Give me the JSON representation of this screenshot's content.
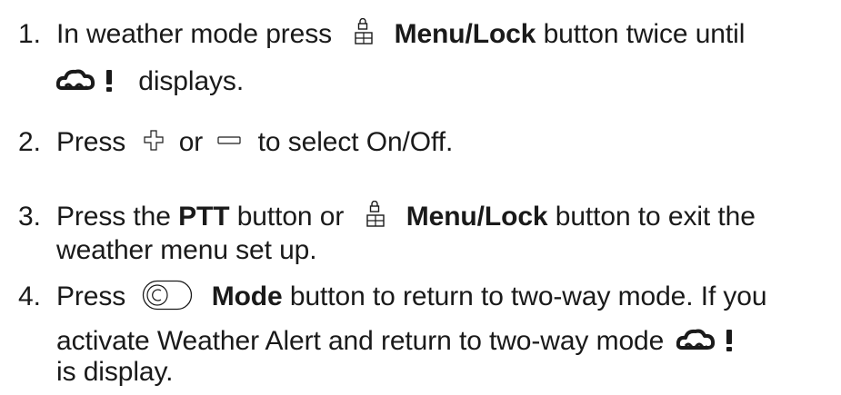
{
  "steps": [
    {
      "number": "1.",
      "line1_a": "In weather mode press",
      "line1_icon": "menu-lock-icon",
      "line1_b": "Menu/Lock",
      "line1_c": "button twice until",
      "line2_icon": "weather-alert-icon",
      "line2_text": "displays."
    },
    {
      "number": "2.",
      "a": "Press",
      "plus_icon": "plus-icon",
      "b": "or",
      "minus_icon": "minus-icon",
      "c": "to select On/Off."
    },
    {
      "number": "3.",
      "line1_a": "Press the",
      "line1_b": "PTT",
      "line1_c": "button or",
      "line1_icon": "menu-lock-icon",
      "line1_d": "Menu/Lock",
      "line1_e": "button to exit the",
      "line2": "weather menu set up."
    },
    {
      "number": "4.",
      "line1_a": "Press",
      "line1_icon": "mode-icon",
      "line1_b": "Mode",
      "line1_c": "button to return to two-way mode. If you",
      "line2_a": "activate Weather Alert and return to two-way mode",
      "line2_icon": "weather-alert-icon",
      "line3": "is display."
    }
  ],
  "colors": {
    "text": "#1a1a1a"
  }
}
